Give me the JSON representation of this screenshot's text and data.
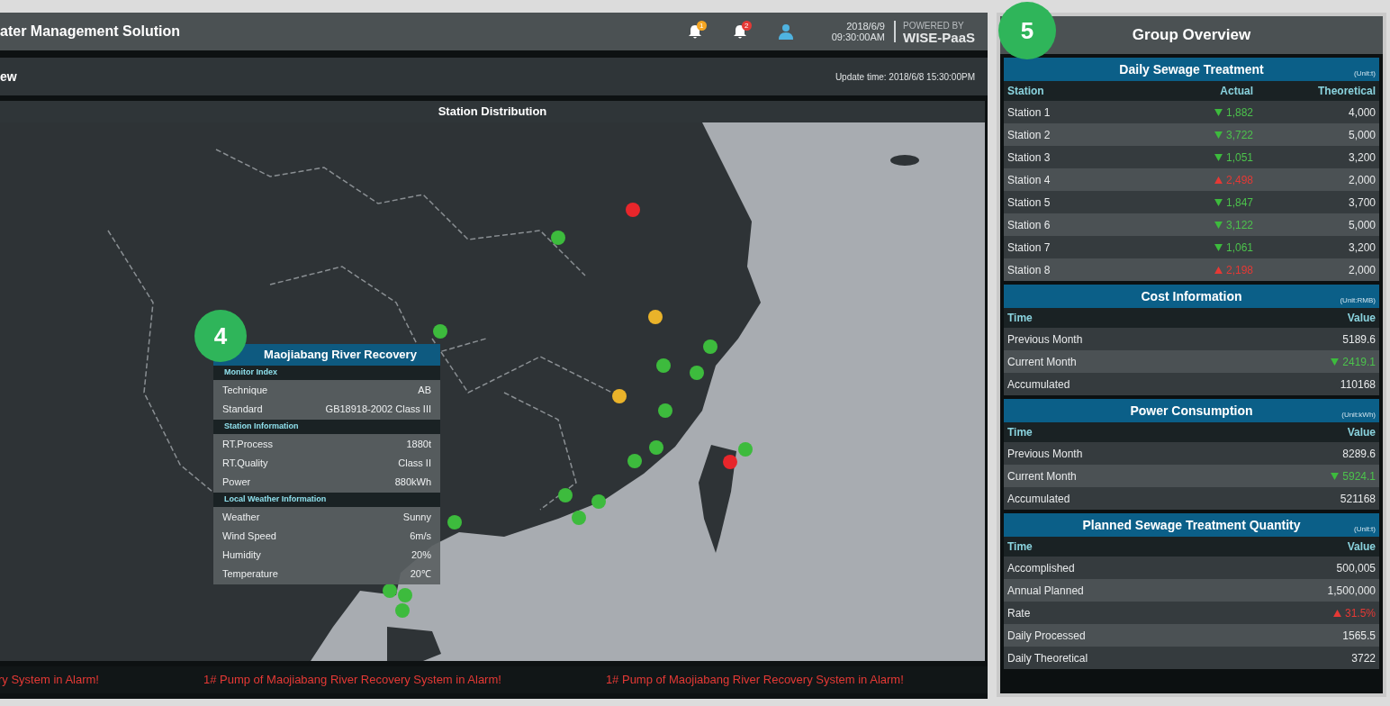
{
  "header": {
    "title": "ater Management Solution",
    "notifications": [
      {
        "count": "1",
        "color": "#f5a623"
      },
      {
        "count": "2",
        "color": "#e53935"
      }
    ],
    "date": "2018/6/9",
    "time": "09:30:00AM",
    "powered_by": "POWERED BY",
    "brand": "WISE-PaaS"
  },
  "subheader": {
    "title": "ew",
    "update_time": "Update time: 2018/6/8 15:30:00PM"
  },
  "map": {
    "title": "Station Distribution",
    "stations": [
      {
        "color": "#e8262b"
      },
      {
        "color": "#3dbb3d"
      },
      {
        "color": "#3dbb3d"
      },
      {
        "color": "#eab32a"
      },
      {
        "color": "#3dbb3d"
      },
      {
        "color": "#3dbb3d"
      },
      {
        "color": "#3dbb3d"
      },
      {
        "color": "#eab32a"
      },
      {
        "color": "#3dbb3d"
      },
      {
        "color": "#3dbb3d"
      },
      {
        "color": "#3dbb3d"
      },
      {
        "color": "#3dbb3d"
      },
      {
        "color": "#3dbb3d"
      },
      {
        "color": "#3dbb3d"
      },
      {
        "color": "#3dbb3d"
      },
      {
        "color": "#3dbb3d"
      },
      {
        "color": "#e8262b"
      },
      {
        "color": "#3dbb3d"
      },
      {
        "color": "#3dbb3d"
      },
      {
        "color": "#3dbb3d"
      }
    ]
  },
  "popup": {
    "title": "Maojiabang River Recovery",
    "sections": [
      {
        "heading": "Monitor Index",
        "rows": [
          {
            "label": "Technique",
            "value": "AB"
          },
          {
            "label": "Standard",
            "value": "GB18918-2002 Class III"
          }
        ]
      },
      {
        "heading": "Station Information",
        "rows": [
          {
            "label": "RT.Process",
            "value": "1880t"
          },
          {
            "label": "RT.Quality",
            "value": "Class II"
          },
          {
            "label": "Power",
            "value": "880kWh"
          }
        ]
      },
      {
        "heading": "Local Weather Information",
        "rows": [
          {
            "label": "Weather",
            "value": "Sunny"
          },
          {
            "label": "Wind Speed",
            "value": "6m/s"
          },
          {
            "label": "Humidity",
            "value": "20%"
          },
          {
            "label": "Temperature",
            "value": "20℃"
          }
        ]
      }
    ]
  },
  "callouts": [
    "4",
    "5"
  ],
  "alarm_ticker": [
    "ry System in Alarm!",
    "1# Pump of Maojiabang River Recovery System in Alarm!",
    "1# Pump of Maojiabang River Recovery System in Alarm!"
  ],
  "group_overview": {
    "title": "Group Overview",
    "tables": [
      {
        "title": "Daily Sewage Treatment",
        "unit": "(Unit:t)",
        "columns": [
          "Station",
          "Actual",
          "Theoretical"
        ],
        "rows": [
          {
            "cells": [
              "Station 1",
              "1,882",
              "4,000"
            ],
            "kind": "down"
          },
          {
            "cells": [
              "Station 2",
              "3,722",
              "5,000"
            ],
            "kind": "down"
          },
          {
            "cells": [
              "Station 3",
              "1,051",
              "3,200"
            ],
            "kind": "down"
          },
          {
            "cells": [
              "Station 4",
              "2,498",
              "2,000"
            ],
            "kind": "up"
          },
          {
            "cells": [
              "Station 5",
              "1,847",
              "3,700"
            ],
            "kind": "down"
          },
          {
            "cells": [
              "Station 6",
              "3,122",
              "5,000"
            ],
            "kind": "down"
          },
          {
            "cells": [
              "Station 7",
              "1,061",
              "3,200"
            ],
            "kind": "down"
          },
          {
            "cells": [
              "Station 8",
              "2,198",
              "2,000"
            ],
            "kind": "up"
          }
        ]
      },
      {
        "title": "Cost Information",
        "unit": "(Unit:RMB)",
        "columns": [
          "Time",
          "Value"
        ],
        "rows": [
          {
            "cells": [
              "Previous Month",
              "5189.6"
            ]
          },
          {
            "cells": [
              "Current Month",
              "2419.1"
            ],
            "kind": "down"
          },
          {
            "cells": [
              "Accumulated",
              "110168"
            ]
          }
        ]
      },
      {
        "title": "Power Consumption",
        "unit": "(Unit:kWh)",
        "columns": [
          "Time",
          "Value"
        ],
        "rows": [
          {
            "cells": [
              "Previous Month",
              "8289.6"
            ]
          },
          {
            "cells": [
              "Current Month",
              "5924.1"
            ],
            "kind": "down"
          },
          {
            "cells": [
              "Accumulated",
              "521168"
            ]
          }
        ]
      },
      {
        "title": "Planned Sewage Treatment Quantity",
        "unit": "(Unit:t)",
        "columns": [
          "Time",
          "Value"
        ],
        "rows": [
          {
            "cells": [
              "Accomplished",
              "500,005"
            ]
          },
          {
            "cells": [
              "Annual Planned",
              "1,500,000"
            ]
          },
          {
            "cells": [
              "Rate",
              "31.5%"
            ],
            "kind": "up"
          },
          {
            "cells": [
              "Daily Processed",
              "1565.5"
            ]
          },
          {
            "cells": [
              "Daily Theoretical",
              "3722"
            ]
          }
        ]
      }
    ]
  }
}
